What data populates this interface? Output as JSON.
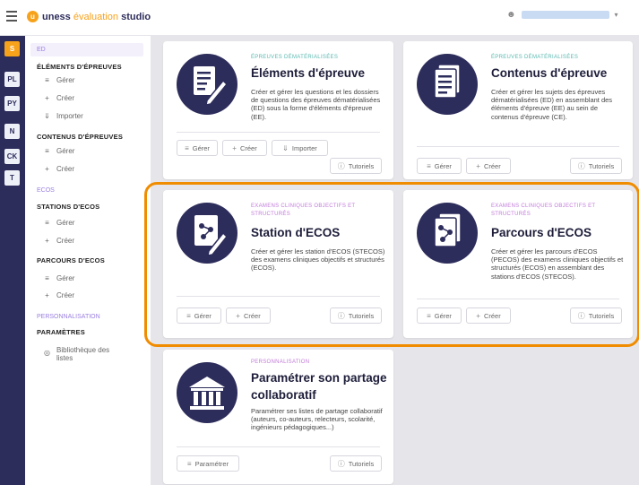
{
  "app": {
    "logo_mark": "u",
    "name_part1": "uness",
    "name_part2": "évaluation",
    "name_part3": "studio",
    "user_icon": "person-icon",
    "user_chevron": "chevron-down-icon"
  },
  "rail": {
    "items": [
      {
        "label": "S"
      },
      {
        "label": "PL"
      },
      {
        "label": "PY"
      },
      {
        "label": "N"
      },
      {
        "label": "CK"
      },
      {
        "label": "T"
      }
    ]
  },
  "sidebar": {
    "sec_ed": "ED",
    "elements_head": "ÉLÉMENTS D'ÉPREUVES",
    "elements_items": [
      "Gérer",
      "Créer",
      "Importer"
    ],
    "contenus_head": "CONTENUS D'ÉPREUVES",
    "contenus_items": [
      "Gérer",
      "Créer"
    ],
    "sec_ecos": "ECOS",
    "stations_head": "STATIONS D'ECOS",
    "stations_items": [
      "Gérer",
      "Créer"
    ],
    "parcours_head": "PARCOURS D'ECOS",
    "parcours_items": [
      "Gérer",
      "Créer"
    ],
    "sec_perso": "PERSONNALISATION",
    "params_head": "PARAMÈTRES",
    "params_item": "Bibliothèque des listes"
  },
  "cards": {
    "elements": {
      "tag": "ÉPREUVES DÉMATÉRIALISÉES",
      "title": "Éléments d'épreuve",
      "desc": "Créer et gérer les questions et les dossiers de questions des épreuves dématérialisées (ED) sous la forme d'éléments d'épreuve (EE).",
      "btn_manage": "Gérer",
      "btn_create": "Créer",
      "btn_import": "Importer",
      "btn_tutorials": "Tutoriels"
    },
    "contenus": {
      "tag": "ÉPREUVES DÉMATÉRIALISÉES",
      "title": "Contenus d'épreuve",
      "desc": "Créer et gérer les sujets des épreuves dématérialisées (ED) en assemblant des éléments d'épreuve (EE) au sein de contenus d'épreuve (CE).",
      "btn_manage": "Gérer",
      "btn_create": "Créer",
      "btn_tutorials": "Tutoriels"
    },
    "station": {
      "tag": "EXAMENS CLINIQUES OBJECTIFS ET STRUCTURÉS",
      "title": "Station d'ECOS",
      "desc": "Créer et gérer les station d'ECOS (STECOS) des examens cliniques objectifs et structurés (ECOS).",
      "btn_manage": "Gérer",
      "btn_create": "Créer",
      "btn_tutorials": "Tutoriels"
    },
    "parcours": {
      "tag": "EXAMENS CLINIQUES OBJECTIFS ET STRUCTURÉS",
      "title": "Parcours d'ECOS",
      "desc": "Créer et gérer les parcours d'ECOS (PECOS) des examens cliniques objectifs et structurés (ECOS) en assemblant des stations d'ECOS (STECOS).",
      "btn_manage": "Gérer",
      "btn_create": "Créer",
      "btn_tutorials": "Tutoriels"
    },
    "partage": {
      "tag": "PERSONNALISATION",
      "title": "Paramétrer son partage collaboratif",
      "desc": "Paramétrer ses listes de partage collaboratif (auteurs, co-auteurs, relecteurs, scolarité, ingénieurs pédagogiques...)",
      "btn_settings": "Paramétrer",
      "btn_tutorials": "Tutoriels"
    }
  },
  "colors": {
    "navy": "#2d2d5c",
    "orange": "#f7a21b",
    "highlight": "#f08c00",
    "teal_tag": "#59b8b0",
    "purple_tag": "#c07ad8"
  }
}
